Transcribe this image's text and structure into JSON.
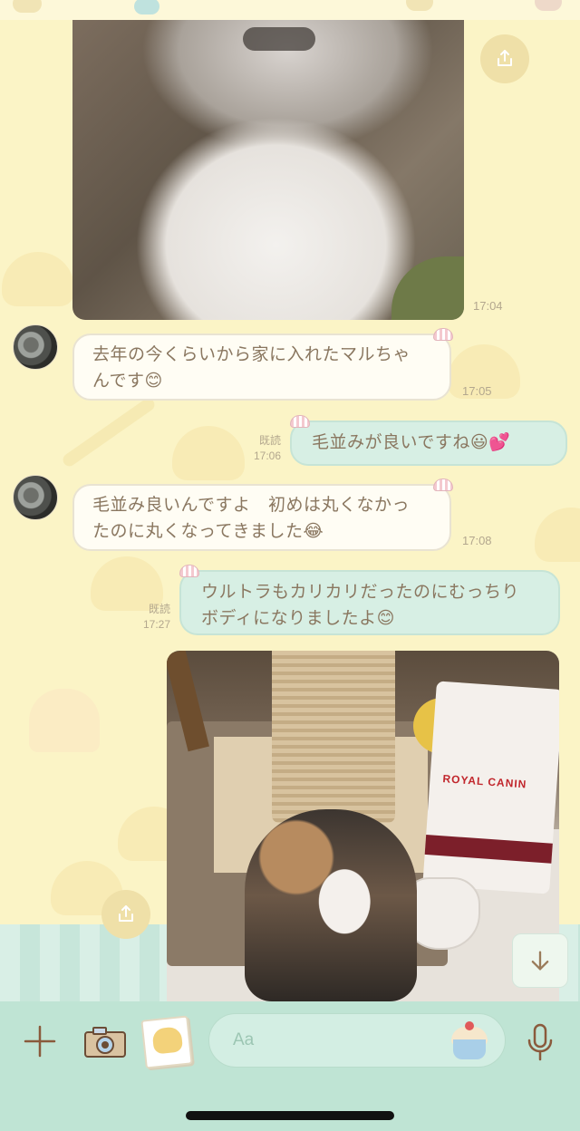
{
  "messages": [
    {
      "type": "image",
      "direction": "incoming",
      "time": "17:04",
      "description_icon": "share-icon"
    },
    {
      "type": "text",
      "direction": "incoming",
      "text_line1": "去年の今くらいから家に入れたマルちゃ",
      "text_line2": "んです😊",
      "time": "17:05"
    },
    {
      "type": "text",
      "direction": "outgoing",
      "text": "毛並みが良いですね😃💕",
      "read": "既読",
      "time": "17:06"
    },
    {
      "type": "text",
      "direction": "incoming",
      "text_line1": "毛並み良いんですよ　初めは丸くなかっ",
      "text_line2": "たのに丸くなってきました😂",
      "time": "17:08"
    },
    {
      "type": "text",
      "direction": "outgoing",
      "text_line1": "ウルトラもカリカリだったのにむっちり",
      "text_line2": "ボディになりましたよ😊",
      "read": "既読",
      "time": "17:27"
    },
    {
      "type": "image",
      "direction": "outgoing",
      "product_text": "ROYAL CANIN"
    }
  ],
  "input": {
    "placeholder": "Aa"
  },
  "colors": {
    "chat_background": "#fbf4c6",
    "outgoing_bubble": "#d7efe4",
    "incoming_bubble": "#fffdf4",
    "input_bar": "#bfe4d4"
  },
  "icons": {
    "plus": "plus-icon",
    "camera": "camera-icon",
    "sticker": "sticker-icon",
    "emoji": "emoji-icon",
    "mic": "microphone-icon",
    "share": "share-icon",
    "scroll_down": "arrow-down-icon"
  }
}
